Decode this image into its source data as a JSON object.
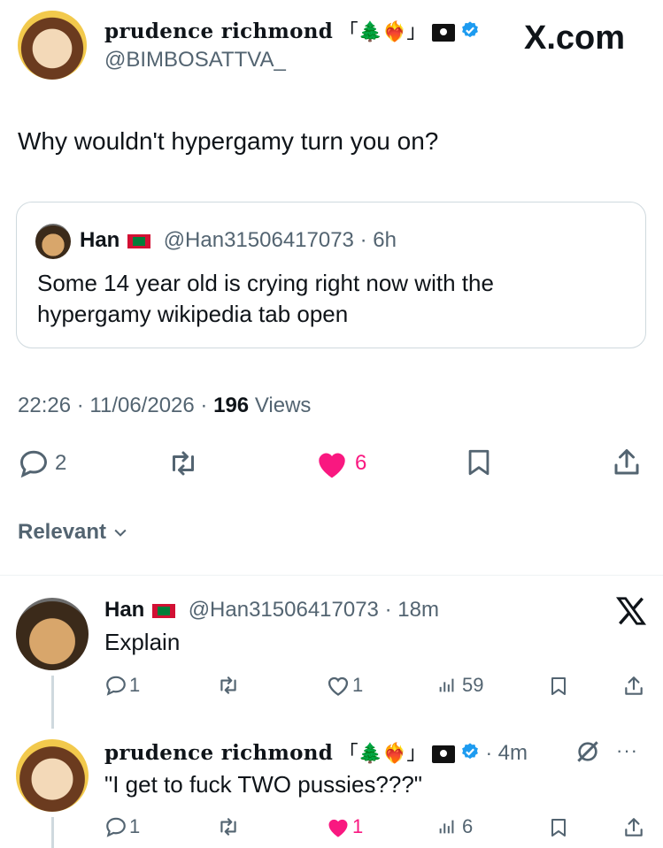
{
  "post": {
    "author_name": "prudence richmond",
    "author_deco": "「🌲❤️‍🔥」",
    "author_handle": "@BIMBOSATTVA_",
    "site_label": "X.com",
    "text": "Why wouldn't hypergamy turn you on?",
    "time": "22:26",
    "date": "11/06/2026",
    "views_count": "196",
    "views_label": "Views",
    "replies": "2",
    "likes": "6"
  },
  "quote": {
    "author_name": "Han",
    "author_handle": "@Han31506417073",
    "time": "6h",
    "text_line1": "Some 14 year old is crying right now with the",
    "text_line2": "hypergamy wikipedia tab open"
  },
  "sort": {
    "label": "Relevant"
  },
  "replies": [
    {
      "author_name": "Han",
      "author_handle": "@Han31506417073",
      "time": "18m",
      "text": "Explain",
      "reply_count": "1",
      "like_count": "1",
      "view_count": "59"
    },
    {
      "author_name": "prudence richmond",
      "author_deco": "「🌲❤️‍🔥」",
      "time": "4m",
      "text": "\"I get to fuck TWO pussies???\"",
      "reply_count": "1",
      "like_count": "1",
      "view_count": "6"
    }
  ],
  "colors": {
    "accent": "#1d9bf0",
    "like": "#f91880",
    "muted": "#536471"
  }
}
